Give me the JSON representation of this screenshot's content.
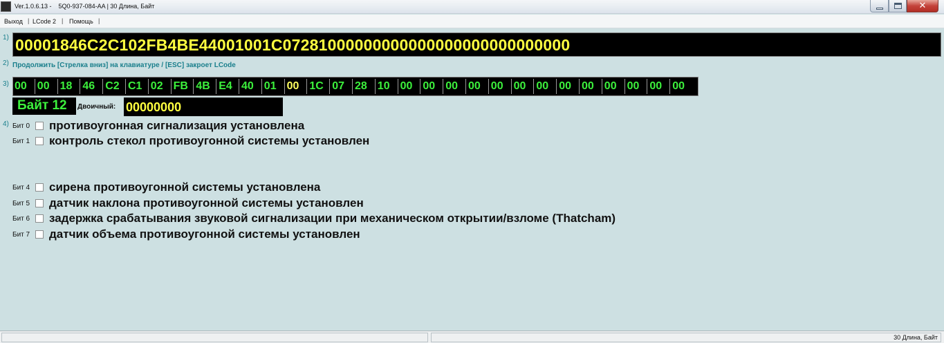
{
  "window": {
    "title": "Ver.1.0.6.13 -    5Q0-937-084-AA | 30 Длина, Байт",
    "minimize_icon": "minimize-icon",
    "maximize_icon": "maximize-icon",
    "close_icon": "close-icon",
    "close_glyph": "✕"
  },
  "menu": {
    "items": [
      "Выход",
      "LCode 2",
      "Помощь"
    ],
    "separator": "|"
  },
  "steps": [
    "1)",
    "2)",
    "3)",
    "4)"
  ],
  "lcode": {
    "value": "00001846C2C102FB4BE44001001C07281000000000000000000000000000"
  },
  "hint": "Продолжить [Стрелка вниз] на клавиатуре / [ESC] закроет LCode",
  "bytes": [
    "00",
    "00",
    "18",
    "46",
    "C2",
    "C1",
    "02",
    "FB",
    "4B",
    "E4",
    "40",
    "01",
    "00",
    "1C",
    "07",
    "28",
    "10",
    "00",
    "00",
    "00",
    "00",
    "00",
    "00",
    "00",
    "00",
    "00",
    "00",
    "00",
    "00",
    "00"
  ],
  "selected_byte_index": 12,
  "byte_editor": {
    "label": "Байт 12",
    "binary_caption": "Двоичный:",
    "binary_value": "00000000"
  },
  "bits": [
    {
      "label": "Бит 0",
      "text": "противоугонная сигнализация установлена",
      "checked": false
    },
    {
      "label": "Бит 1",
      "text": "контроль стекол противоугонной системы установлен",
      "checked": false
    },
    {
      "label": "Бит 4",
      "text": "сирена противоугонной системы установлена",
      "checked": false
    },
    {
      "label": "Бит 5",
      "text": "датчик наклона противоугонной системы установлен",
      "checked": false
    },
    {
      "label": "Бит 6",
      "text": "задержка срабатывания звуковой сигнализации при механическом открытии/взломе (Thatcham)",
      "checked": false
    },
    {
      "label": "Бит 7",
      "text": "датчик объема противоугонной системы установлен",
      "checked": false
    }
  ],
  "statusbar": {
    "right_text": "30 Длина, Байт"
  },
  "colors": {
    "background": "#cde0e2",
    "byte_green": "#3cf03c",
    "highlight_yellow": "#ffff40",
    "step_teal": "#1a7f8c"
  }
}
